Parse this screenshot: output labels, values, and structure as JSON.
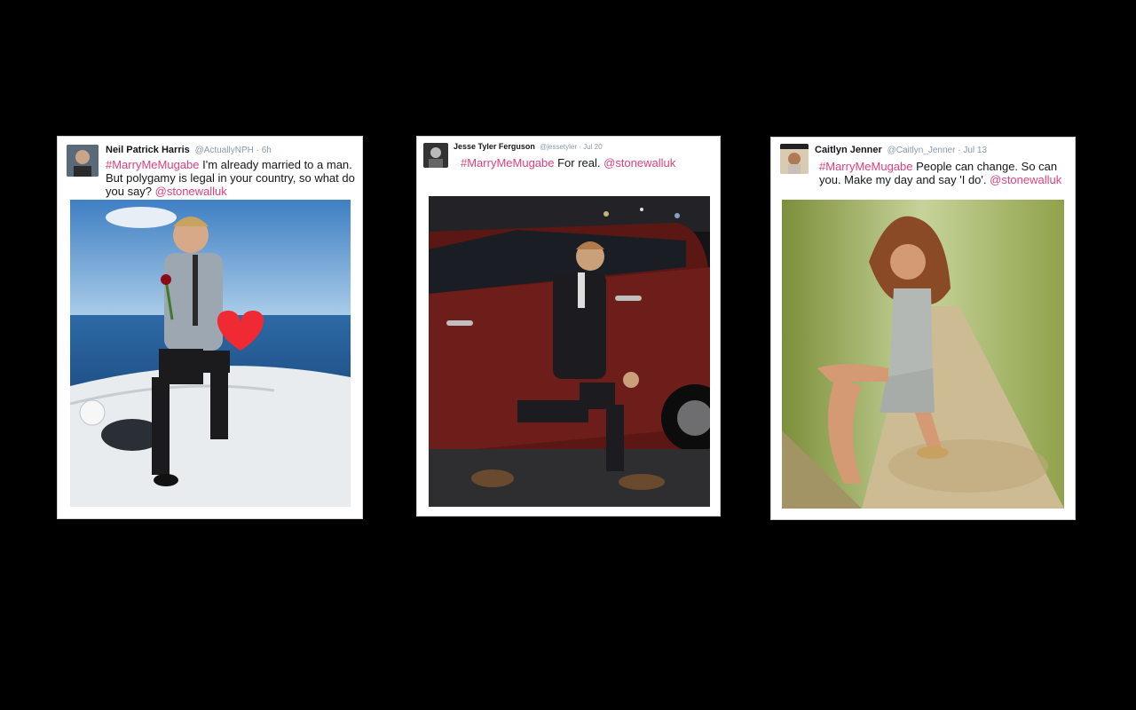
{
  "tweets": [
    {
      "name": "Neil Patrick Harris",
      "handle": "@ActuallyNPH",
      "sep": "·",
      "time": "6h",
      "hashtag": "#MarryMeMugabe",
      "body": " I'm already married to a man. But polygamy is legal in your country, so what do you say? ",
      "mention": "@stonewalluk",
      "avatar_icon": "profile-photo-icon",
      "photo_icon": "man-kneeling-on-boat-with-rose-and-heart-icon"
    },
    {
      "name": "Jesse Tyler Ferguson",
      "handle": "@jessetyler",
      "sep": "·",
      "time": "Jul 20",
      "hashtag": "#MarryMeMugabe",
      "body": "  For real. ",
      "mention": "@stonewalluk",
      "avatar_icon": "profile-photo-icon",
      "photo_icon": "man-kneeling-beside-red-car-icon"
    },
    {
      "name": "Caitlyn Jenner",
      "handle": "@Caitlyn_Jenner",
      "sep": "·",
      "time": "Jul 13",
      "hashtag": "#MarryMeMugabe",
      "body": " People can change. So can you. Make my day and say 'I do'. ",
      "mention": "@stonewalluk",
      "avatar_icon": "magazine-cover-icon",
      "photo_icon": "woman-kneeling-on-forest-path-icon"
    }
  ],
  "colors": {
    "background": "#000000",
    "link_pink": "#e0407c",
    "handle_gray": "#8899a6"
  }
}
